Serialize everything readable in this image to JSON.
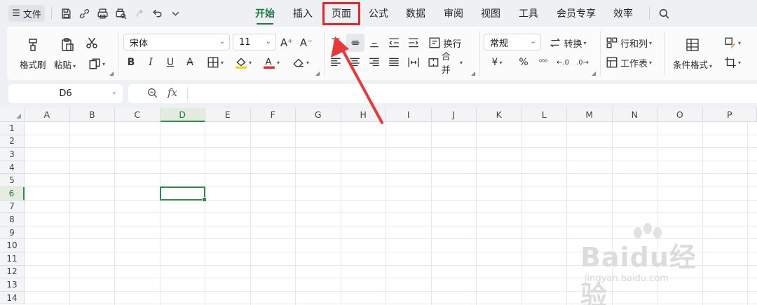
{
  "topbar": {
    "menu_label": "文件",
    "tabs": [
      "开始",
      "插入",
      "页面",
      "公式",
      "数据",
      "审阅",
      "视图",
      "工具",
      "会员专享",
      "效率"
    ],
    "active_tab": "开始",
    "highlighted_tab": "页面"
  },
  "ribbon": {
    "format_painter": "格式刷",
    "paste": "粘贴",
    "font_name": "宋体",
    "font_size": "11",
    "wrap_text": "换行",
    "merge": "合并",
    "number_format": "常规",
    "convert": "转换",
    "rows_cols": "行和列",
    "worksheet": "工作表",
    "conditional_format": "条件格式"
  },
  "formula_bar": {
    "cell_ref": "D6",
    "fx": "fx"
  },
  "sheet": {
    "columns": [
      "A",
      "B",
      "C",
      "D",
      "E",
      "F",
      "G",
      "H",
      "I",
      "J",
      "K",
      "L",
      "M",
      "N",
      "O",
      "P"
    ],
    "rows": [
      "1",
      "2",
      "3",
      "4",
      "5",
      "6",
      "7",
      "8",
      "9",
      "10",
      "11",
      "12",
      "13",
      "14"
    ],
    "selected_column": "D",
    "selected_row": "6"
  },
  "watermark": {
    "brand": "Bai",
    "brand2": "du",
    "brand3": "经验",
    "url": "jingyan.baidu.com"
  },
  "colors": {
    "accent": "#1a7a3d",
    "highlight": "#e02a2a",
    "selection": "#2e8b47"
  }
}
